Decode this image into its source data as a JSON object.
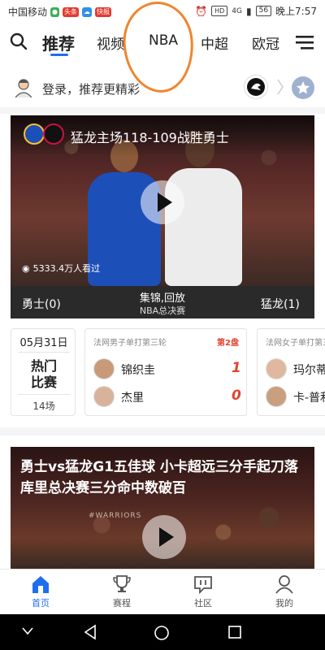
{
  "status_bar": {
    "carrier": "中国移动",
    "chip1": "头条",
    "chip2": "快报",
    "hd": "HD",
    "signal": "4G",
    "battery": "56",
    "time": "晚上7:57"
  },
  "top_nav": {
    "tabs": [
      "推荐",
      "视频",
      "NBA",
      "中超",
      "欧冠"
    ],
    "active_index": 0,
    "accent": "#1e6ff0",
    "annotation_color": "#f0852e"
  },
  "login_row": {
    "text": "登录，推荐更精彩"
  },
  "video_card": {
    "title": "猛龙主场118-109战胜勇士",
    "views": "5333.4万人看过",
    "home_team_score": "勇士(0)",
    "away_team_score": "猛龙(1)",
    "center_title": "集锦,回放",
    "center_sub": "NBA总决赛"
  },
  "schedule": {
    "date": "05月31日",
    "hot_label_line1": "热门",
    "hot_label_line2": "比赛",
    "count": "14场",
    "matches": [
      {
        "event": "法网男子单打第三轮",
        "set_label": "第2盘",
        "players": [
          {
            "name": "锦织圭",
            "score": "1"
          },
          {
            "name": "杰里",
            "score": "0"
          }
        ]
      },
      {
        "event": "法网女子单打第三轮",
        "players": [
          {
            "name": "玛尔蒂"
          },
          {
            "name": "卡-普利"
          }
        ]
      }
    ]
  },
  "second_card": {
    "title": "勇士vs猛龙G1五佳球 小卡超远三分手起刀落库里总决赛三分命中数破百",
    "caption": "#WARRIORS"
  },
  "tab_bar": {
    "items": [
      "首页",
      "赛程",
      "社区",
      "我的"
    ],
    "active_index": 0
  }
}
